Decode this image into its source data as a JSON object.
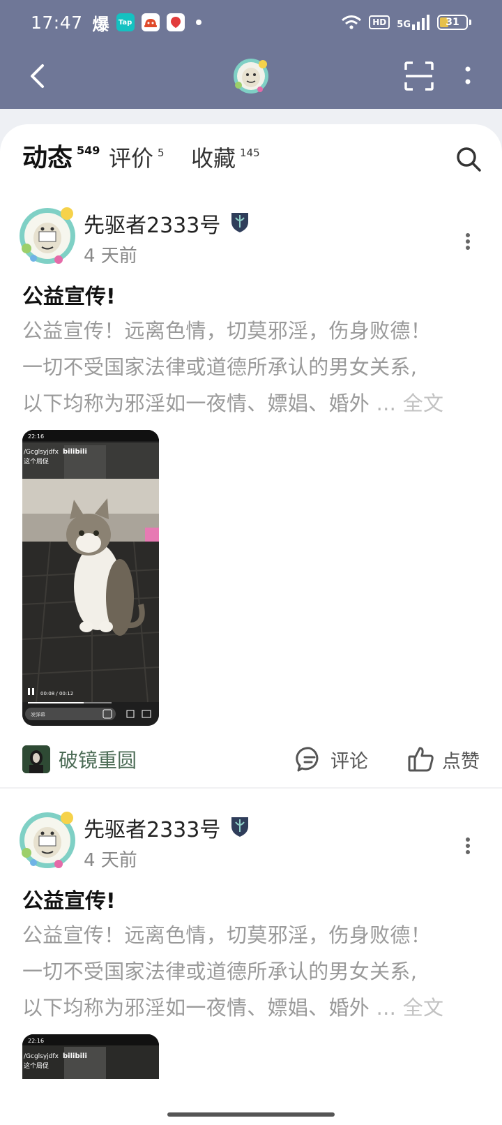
{
  "status_bar": {
    "time": "17:47",
    "app_icons": [
      {
        "label": "爆",
        "icon": "baozou-icon"
      },
      {
        "label": "Tap",
        "icon": "taptap-icon",
        "color": "#14c1c1"
      },
      {
        "label": "",
        "icon": "game-icon",
        "color": "#e04a2a"
      },
      {
        "label": "",
        "icon": "dewu-icon",
        "color": "#e23b3b"
      }
    ],
    "hd": "HD",
    "network": "5G",
    "battery": "31"
  },
  "header": {
    "back_icon": "chevron-left-icon",
    "scan_icon": "scan-icon",
    "more_icon": "vertical-dots-icon"
  },
  "tabs": [
    {
      "label": "动态",
      "count": "549",
      "active": true
    },
    {
      "label": "评价",
      "count": "5",
      "active": false
    },
    {
      "label": "收藏",
      "count": "145",
      "active": false
    }
  ],
  "accent_color": "#19c2b4",
  "posts": [
    {
      "author": "先驱者2333号",
      "time": "4 天前",
      "title": "公益宣传!",
      "body_lines": [
        "公益宣传！远离色情，切莫邪淫，伤身败德！",
        "一切不受国家法律或道德所承认的男女关系,",
        "以下均称为邪淫如一夜情、嫖娼、婚外"
      ],
      "ellipsis": "...",
      "full_text": "全文",
      "video": {
        "status_time": "22:16",
        "channel": "/Gcglsyjdfx",
        "brand": "bilibili",
        "caption": "这个局促",
        "playback": "00:08 / 00:12",
        "comment_placeholder": "发弹幕"
      },
      "circle_name": "破镜重圆",
      "comment_label": "评论",
      "like_label": "点赞"
    },
    {
      "author": "先驱者2333号",
      "time": "4 天前",
      "title": "公益宣传!",
      "body_lines": [
        "公益宣传！远离色情，切莫邪淫，伤身败德！",
        "一切不受国家法律或道德所承认的男女关系,",
        "以下均称为邪淫如一夜情、嫖娼、婚外"
      ],
      "ellipsis": "...",
      "full_text": "全文",
      "video": {
        "status_time": "22:16",
        "channel": "/Gcglsyjdfx",
        "brand": "bilibili",
        "caption": "这个局促"
      }
    }
  ]
}
